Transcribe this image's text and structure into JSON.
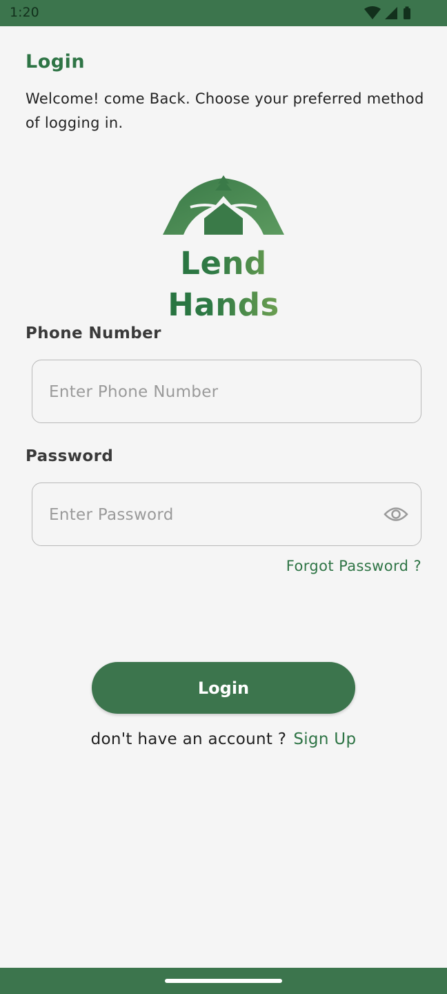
{
  "status_bar": {
    "time": "1:20",
    "icons": [
      "wifi-icon",
      "signal-icon",
      "battery-icon"
    ]
  },
  "header": {
    "title": "Login",
    "subtitle": "Welcome! come Back. Choose your preferred method of logging in."
  },
  "logo": {
    "text": "Lend Hands"
  },
  "form": {
    "phone": {
      "label": "Phone Number",
      "placeholder": "Enter Phone Number",
      "value": ""
    },
    "password": {
      "label": "Password",
      "placeholder": "Enter Password",
      "value": "",
      "toggle_icon": "eye-icon"
    },
    "forgot_label": "Forgot Password ?",
    "submit_label": "Login"
  },
  "footer": {
    "prompt": "don't have an account ?",
    "signup_label": "Sign Up"
  },
  "colors": {
    "brand_green": "#3c754d",
    "title_green": "#2e7445",
    "logo_gradient_end": "#98b95a",
    "background": "#f5f5f5"
  }
}
